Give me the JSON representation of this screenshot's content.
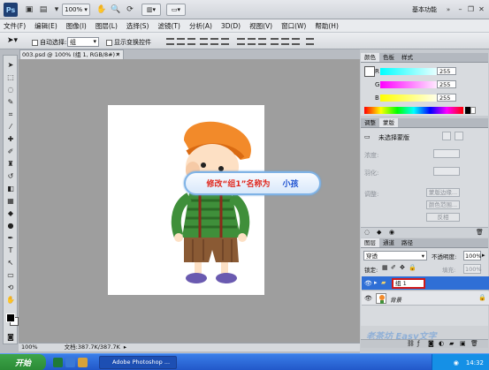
{
  "app": {
    "logo": "Ps",
    "zoom_select": "100%",
    "workspace_label": "基本功能"
  },
  "menu": [
    "文件(F)",
    "编辑(E)",
    "图像(I)",
    "图层(L)",
    "选择(S)",
    "滤镜(T)",
    "分析(A)",
    "3D(D)",
    "视图(V)",
    "窗口(W)",
    "帮助(H)"
  ],
  "options": {
    "auto_select_label": "自动选择:",
    "auto_select_value": "组",
    "show_transform_label": "显示变换控件"
  },
  "document": {
    "tab_title": "003.psd @ 100% (组 1, RGB/8#) *",
    "status_zoom": "100%",
    "status_doc": "文档:387.7K/387.7K"
  },
  "callout": {
    "prefix": "修改“组1”名称为",
    "target": "小孩"
  },
  "color_panel": {
    "tabs": [
      "颜色",
      "色板",
      "样式"
    ],
    "r_label": "R",
    "g_label": "G",
    "b_label": "B",
    "r_value": "255",
    "g_value": "255",
    "b_value": "255"
  },
  "adjust_panel": {
    "tabs": [
      "调整",
      "蒙版"
    ],
    "header": "未选择蒙版",
    "density_label": "浓度:",
    "feather_label": "羽化:",
    "refine_label": "调整:",
    "btn_edge": "蒙版边缘...",
    "btn_color_range": "颜色范围...",
    "btn_invert": "反相"
  },
  "layers_panel": {
    "tabs": [
      "图层",
      "通道",
      "路径"
    ],
    "blend_mode": "穿透",
    "opacity_label": "不透明度:",
    "opacity_value": "100%",
    "lock_label": "锁定:",
    "fill_label": "填充:",
    "fill_value": "100%",
    "layers": [
      {
        "name": "组 1",
        "selected": true
      },
      {
        "name": "背景",
        "selected": false
      }
    ]
  },
  "taskbar": {
    "start_label": "开始",
    "task_label": "Adobe Photoshop ...",
    "clock": "14:32"
  },
  "watermark": "老茶坊 Easy文字",
  "colors": {
    "accent_blue": "#2f6fd6",
    "callout_red": "#e0281e",
    "callout_blue": "#1a4fd0",
    "canvas_gray": "#9e9e9e"
  }
}
